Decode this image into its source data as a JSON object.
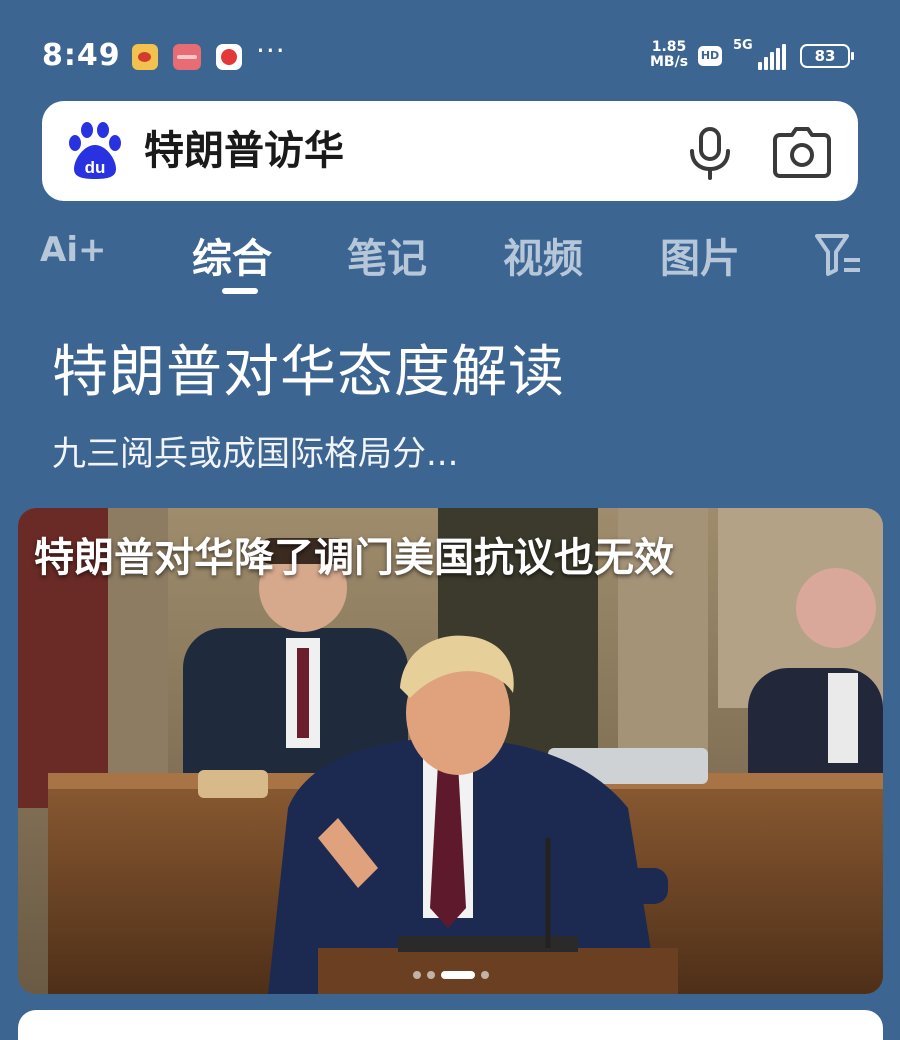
{
  "status_bar": {
    "time": "8:49",
    "more": "···",
    "net_speed_value": "1.85",
    "net_speed_unit": "MB/s",
    "hd": "HD",
    "network": "5G",
    "battery": "83"
  },
  "search": {
    "query": "特朗普访华",
    "logo_text": "du"
  },
  "tabs": {
    "ai_label": "Ai+",
    "items": [
      {
        "label": "综合",
        "active": true
      },
      {
        "label": "笔记",
        "active": false
      },
      {
        "label": "视频",
        "active": false
      },
      {
        "label": "图片",
        "active": false
      }
    ]
  },
  "headline": {
    "title": "特朗普对华态度解读",
    "subtitle": "九三阅兵或成国际格局分..."
  },
  "card": {
    "caption": "特朗普对华降了调门美国抗议也无效",
    "carousel_dots": 4,
    "active_dot": 2
  },
  "colors": {
    "background": "#3d6592",
    "tab_inactive": "#b6c7d9",
    "baidu_blue": "#2932e1"
  }
}
